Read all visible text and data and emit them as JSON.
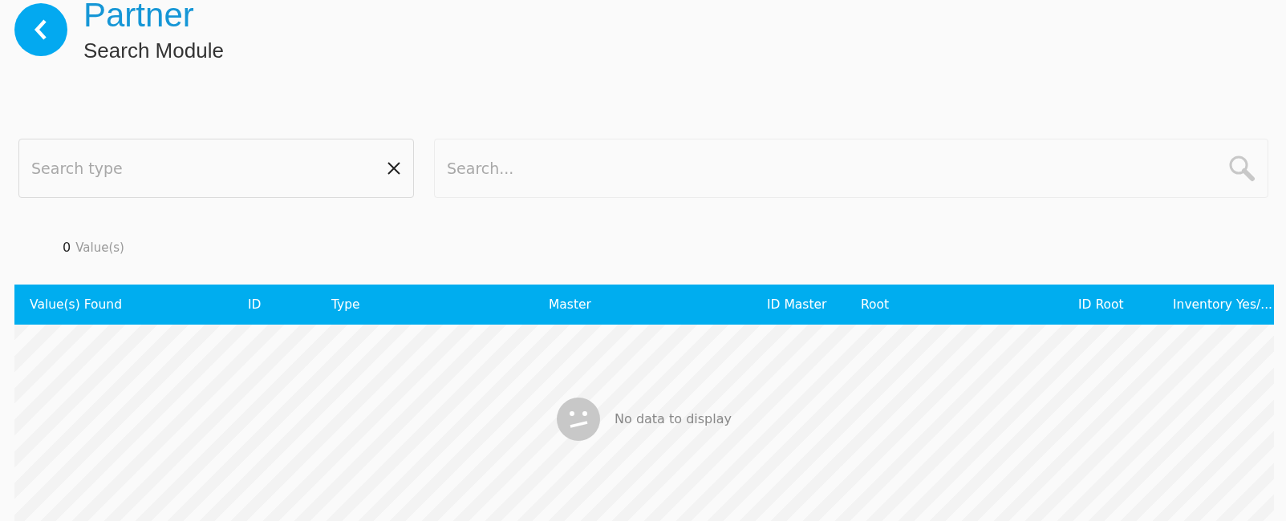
{
  "header": {
    "title": "Partner",
    "subtitle": "Search Module"
  },
  "filters": {
    "search_type": {
      "placeholder": "Search type"
    },
    "search": {
      "placeholder": "Search..."
    }
  },
  "count": {
    "value": "0",
    "label": "Value(s)"
  },
  "table": {
    "columns": [
      "Value(s) Found",
      "ID",
      "Type",
      "Master",
      "ID Master",
      "Root",
      "ID Root",
      "Inventory Yes/..."
    ],
    "empty_message": "No data to display"
  }
}
